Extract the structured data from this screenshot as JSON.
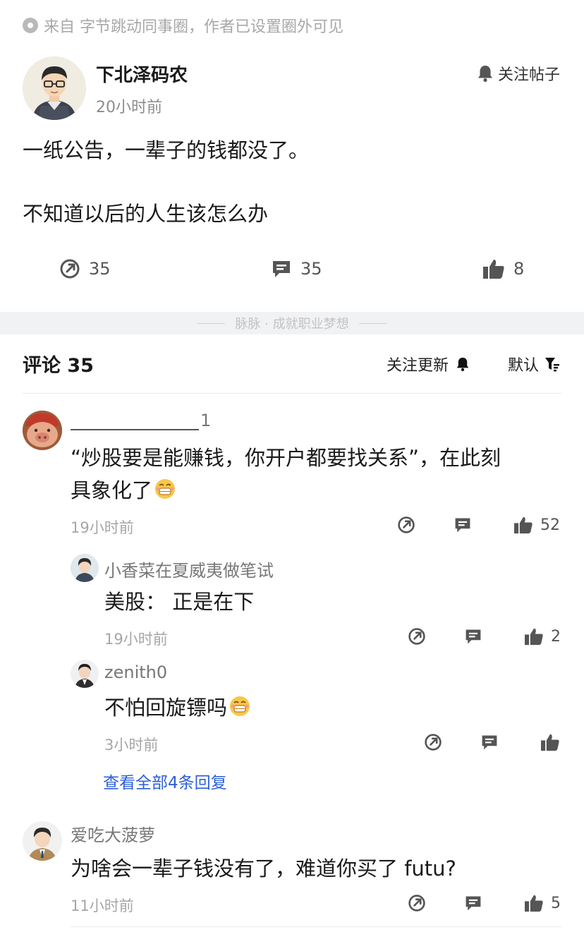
{
  "source": {
    "text": "来自 字节跳动同事圈，作者已设置圈外可见",
    "icon": "circle-dot-icon"
  },
  "post": {
    "author": "下北泽码农",
    "time": "20小时前",
    "follow_label": "关注帖子",
    "body_line1": "一纸公告，一辈子的钱都没了。",
    "body_line2": "不知道以后的人生该怎么办",
    "share_count": "35",
    "comment_count": "35",
    "like_count": "8"
  },
  "divider": {
    "slogan": "脉脉 · 成就职业梦想"
  },
  "comments_header": {
    "title": "评论 35",
    "follow_updates": "关注更新",
    "sort": "默认"
  },
  "comments": [
    {
      "name_suffix": "1",
      "text": "“炒股要是能赚钱，你开户都要找关系”，在此刻具象化了",
      "text_line1": "“炒股要是能赚钱，你开户都要找关系”，在此刻",
      "text_line2": "具象化了",
      "time": "19小时前",
      "likes": "52",
      "replies": [
        {
          "name": "小香菜在夏威夷做笔试",
          "text": "美股：  正是在下",
          "time": "19小时前",
          "likes": "2"
        },
        {
          "name": "zenith0",
          "text": "不怕回旋镖吗",
          "time": "3小时前",
          "likes": ""
        }
      ],
      "view_all": "查看全部4条回复"
    },
    {
      "name": "爱吃大菠萝",
      "text": "为啥会一辈子钱没有了，难道你买了 futu?",
      "time": "11小时前",
      "likes": "5"
    }
  ],
  "colors": {
    "link": "#2c5fd9",
    "muted": "#a6a6a6",
    "divider_bg": "#f1f2f4"
  }
}
